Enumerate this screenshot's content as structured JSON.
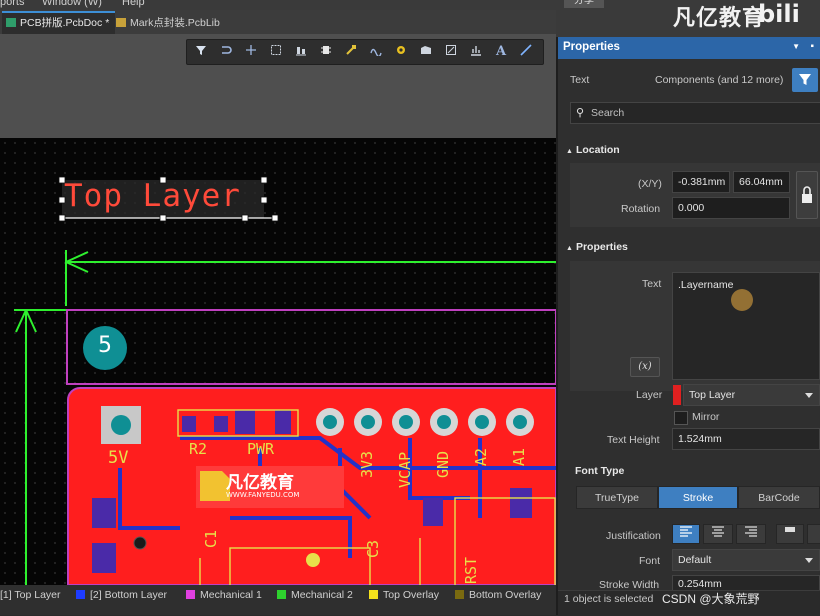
{
  "menubar": {
    "items": [
      "ports",
      "Window (W)",
      "Help"
    ]
  },
  "tabs": [
    {
      "label": "PCB拼版.PcbDoc *",
      "active": true
    },
    {
      "label": "Mark点封装.PcbLib",
      "active": false
    }
  ],
  "toolbar": {
    "icons": [
      "filter-icon",
      "route-icon",
      "cross-icon",
      "rect-select-icon",
      "align-icon",
      "component-icon",
      "net-color-icon",
      "arc-icon",
      "via-icon",
      "pad-icon",
      "region-icon",
      "chart-icon",
      "text-icon",
      "line-icon"
    ],
    "text_glyph": "A"
  },
  "pcb": {
    "text_string": "Top Layer",
    "circle_number": "5",
    "silk_labels": [
      "5V",
      "R2",
      "PWR",
      "3V3",
      "VCAP",
      "GND",
      "A2",
      "A1",
      "C1",
      "C3",
      "RST"
    ],
    "logo_text": "凡亿教育",
    "logo_url": "WWW.FANYEDU.COM",
    "colors": {
      "copper": "#ff2020",
      "silk": "#e8e04a",
      "dimension": "#2ef02e",
      "keepout": "#c040c0",
      "text_selected": "#ff4a3a"
    }
  },
  "layers": [
    {
      "label": "[1] Top Layer",
      "color": "#c62828"
    },
    {
      "label": "[2] Bottom Layer",
      "color": "#1e3cff"
    },
    {
      "label": "Mechanical 1",
      "color": "#e040e0"
    },
    {
      "label": "Mechanical 2",
      "color": "#2ed12e"
    },
    {
      "label": "Top Overlay",
      "color": "#f3e11c"
    },
    {
      "label": "Bottom Overlay",
      "color": "#7a6a10"
    }
  ],
  "panel": {
    "title": "Properties",
    "filter_label": "Text",
    "filter_value": "Components (and 12 more)",
    "search_placeholder": "Search",
    "location": {
      "section": "Location",
      "xy_label": "(X/Y)",
      "x": "-0.381mm",
      "y": "66.04mm",
      "rotation_label": "Rotation",
      "rotation": "0.000"
    },
    "properties": {
      "section": "Properties",
      "text_label": "Text",
      "text_value": ".Layername",
      "fx_button": "(x)",
      "layer_label": "Layer",
      "layer_value": "Top Layer",
      "mirror_label": "Mirror",
      "text_height_label": "Text Height",
      "text_height": "1.524mm"
    },
    "font_type": {
      "section": "Font Type",
      "options": [
        "TrueType",
        "Stroke",
        "BarCode"
      ],
      "selected": "Stroke",
      "justification_label": "Justification",
      "font_label": "Font",
      "font_value": "Default",
      "stroke_width_label": "Stroke Width",
      "stroke_width": "0.254mm"
    },
    "status": "1 object is selected"
  },
  "overlay": {
    "watermark": "凡亿教育",
    "watermark_site": "bilibili",
    "credit": "CSDN @大象荒野",
    "top_right_button": "分享"
  }
}
